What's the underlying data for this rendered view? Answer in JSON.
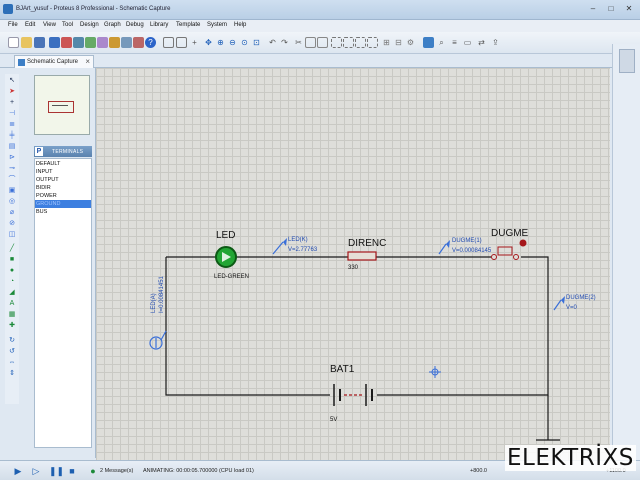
{
  "window": {
    "title": "BJArt_yusuf - Proteus 8 Professional - Schematic Capture"
  },
  "menu": [
    "File",
    "Edit",
    "View",
    "Tool",
    "Design",
    "Graph",
    "Debug",
    "Library",
    "Template",
    "System",
    "Help"
  ],
  "tab": {
    "label": "Schematic Capture"
  },
  "side_panel": {
    "header": "TERMINALS",
    "header_button": "P",
    "items": [
      "DEFAULT",
      "INPUT",
      "OUTPUT",
      "BIDIR",
      "POWER",
      "GROUND",
      "BUS"
    ],
    "selected": "GROUND"
  },
  "schematic": {
    "led": {
      "name": "LED",
      "part": "LED-GREEN"
    },
    "led_k_probe": {
      "name": "LED(K)",
      "value": "V=2.77763"
    },
    "led_a_probe": {
      "name": "LED(A)",
      "value": "I=0.00841451"
    },
    "resistor": {
      "name": "DIRENC",
      "value": "330"
    },
    "dugme1_probe": {
      "name": "DUGME(1)",
      "value": "V=0.00084145"
    },
    "button": {
      "name": "DUGME"
    },
    "dugme2_probe": {
      "name": "DUGME(2)",
      "value": "V=0"
    },
    "battery": {
      "name": "BAT1",
      "value": "5V"
    }
  },
  "status": {
    "messages": "2 Message(s)",
    "animation": "ANIMATING: 00:00:05.700000 (CPU load 01)",
    "coords": "+800.0",
    "coords2": "+1100.0"
  },
  "watermark": "ELEKTRİXS",
  "colors": {
    "led_green": "#22a534",
    "probe_blue": "#3a6fd8",
    "wire": "#1a1a1a",
    "component_red": "#a5171b"
  }
}
